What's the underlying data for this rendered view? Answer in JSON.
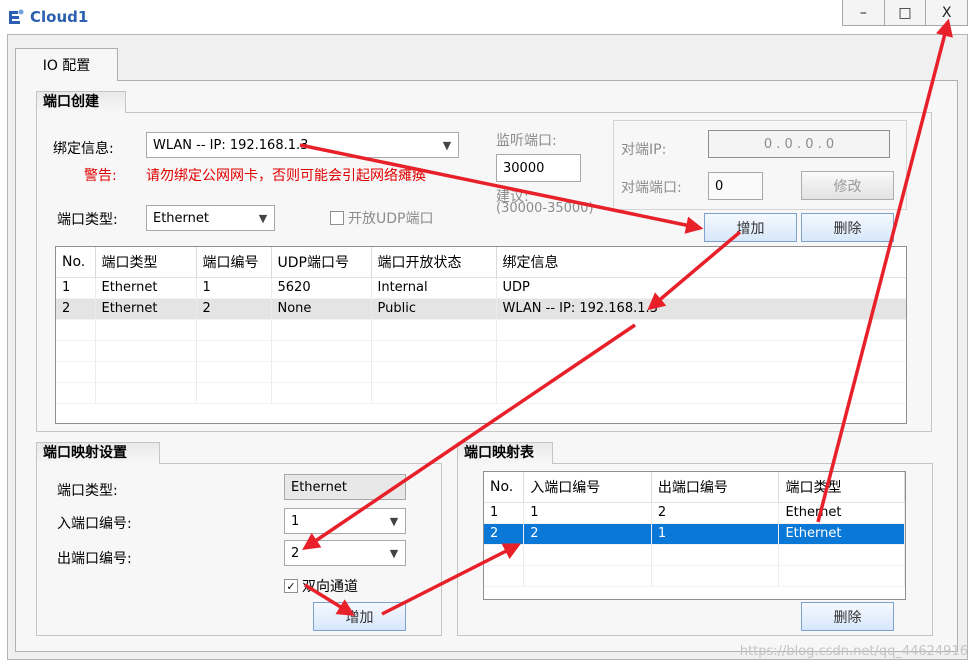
{
  "window": {
    "title": "Cloud1",
    "minimize": "–",
    "maximize": "□",
    "close": "X"
  },
  "tab": {
    "label": "IO 配置"
  },
  "port_create": {
    "title": "端口创建",
    "bind_label": "绑定信息:",
    "bind_value": "WLAN -- IP: 192.168.1.3",
    "warning_label": "警告:",
    "warning_text": "请勿绑定公网网卡，否则可能会引起网络瘫痪",
    "port_type_label": "端口类型:",
    "port_type_value": "Ethernet",
    "udp_checkbox_label": "开放UDP端口",
    "listen_port_label": "监听端口:",
    "listen_port_value": "30000",
    "suggest_label": "建议:",
    "suggest_range": "(30000-35000)",
    "peer_ip_label": "对端IP:",
    "peer_ip_value": "0 . 0 . 0 . 0",
    "peer_port_label": "对端端口:",
    "peer_port_value": "0",
    "modify_button": "修改",
    "add_button": "增加",
    "delete_button": "删除",
    "table": {
      "columns": [
        "No.",
        "端口类型",
        "端口编号",
        "UDP端口号",
        "端口开放状态",
        "绑定信息"
      ],
      "rows": [
        [
          "1",
          "Ethernet",
          "1",
          "5620",
          "Internal",
          "UDP"
        ],
        [
          "2",
          "Ethernet",
          "2",
          "None",
          "Public",
          "WLAN -- IP: 192.168.1.3"
        ]
      ]
    }
  },
  "mapping_setup": {
    "title": "端口映射设置",
    "port_type_label": "端口类型:",
    "port_type_value": "Ethernet",
    "in_port_label": "入端口编号:",
    "in_port_value": "1",
    "out_port_label": "出端口编号:",
    "out_port_value": "2",
    "bidirectional_label": "双向通道",
    "bidirectional_checked": "✓",
    "add_button": "增加"
  },
  "mapping_table": {
    "title": "端口映射表",
    "columns": [
      "No.",
      "入端口编号",
      "出端口编号",
      "端口类型"
    ],
    "rows": [
      [
        "1",
        "1",
        "2",
        "Ethernet"
      ],
      [
        "2",
        "2",
        "1",
        "Ethernet"
      ]
    ],
    "delete_button": "删除"
  },
  "watermark": "https://blog.csdn.net/qq_44624916",
  "colors": {
    "annotation_arrow": "#e8202a",
    "selection": "#0a78d7"
  }
}
